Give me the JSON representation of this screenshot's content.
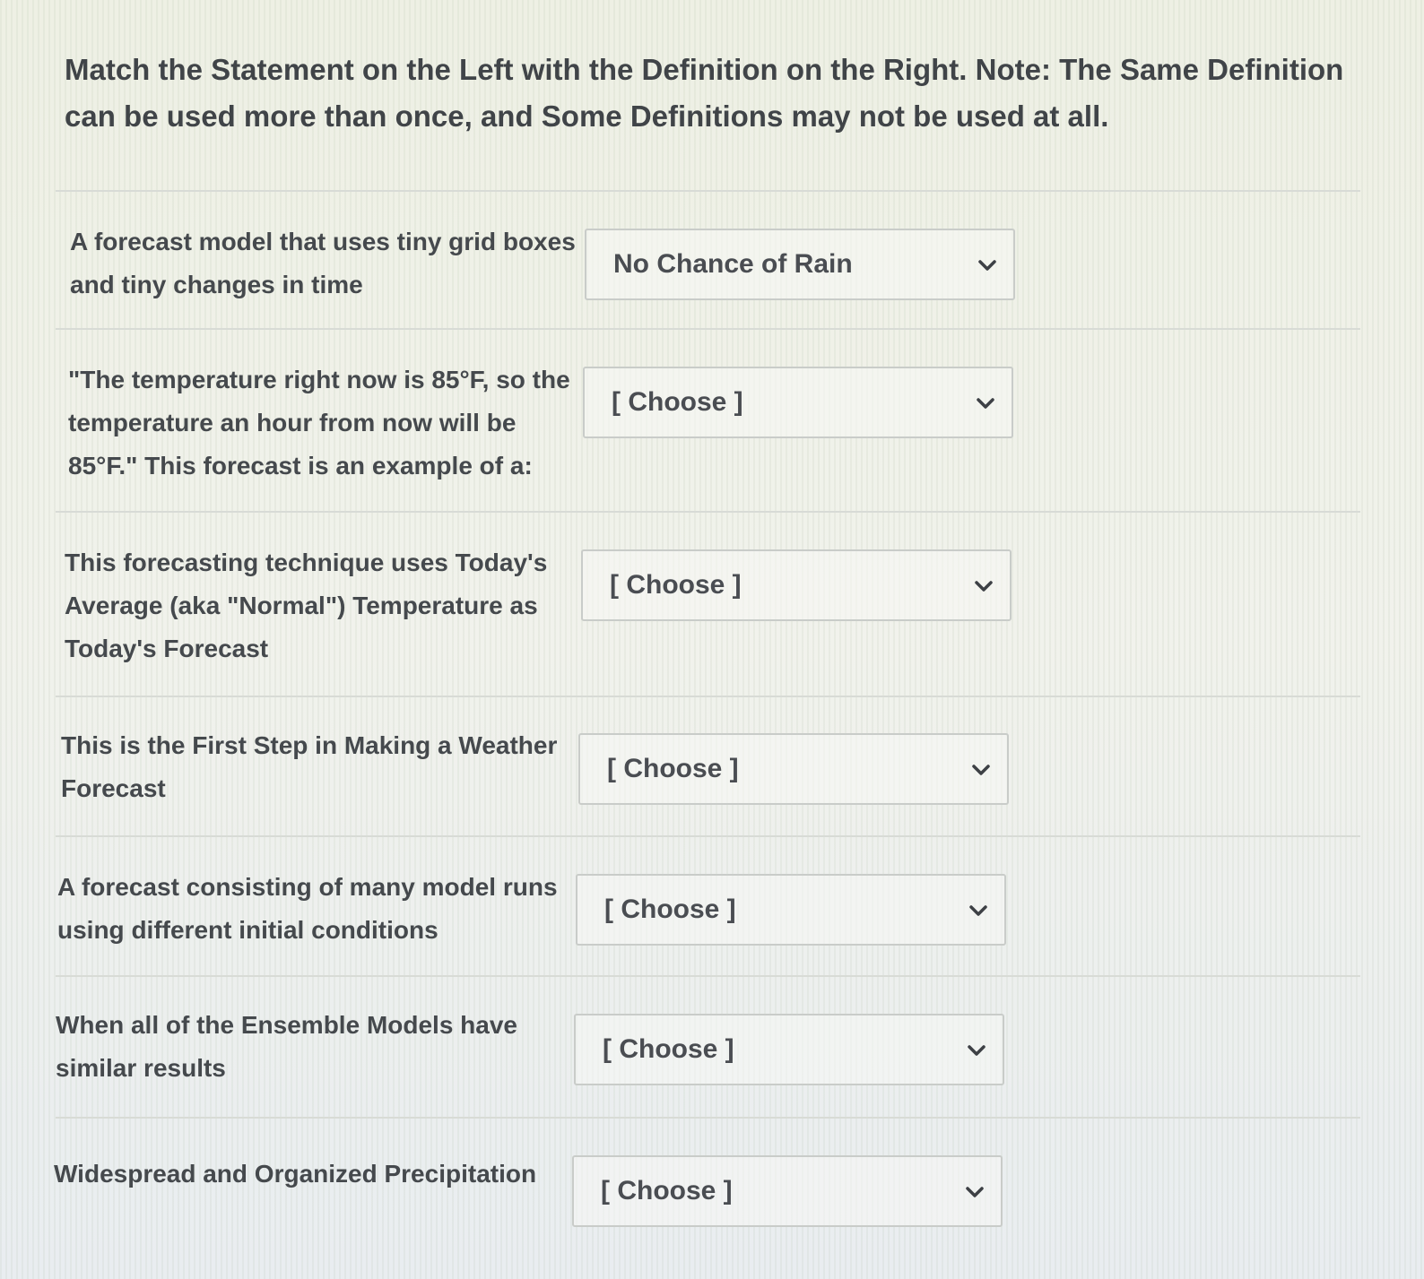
{
  "instructions": "Match the Statement on the Left with the Definition on the Right. Note: The Same Definition can be used more than once, and Some Definitions may not be used at all.",
  "items": [
    {
      "statement": "A forecast model that uses tiny grid boxes and tiny changes in time",
      "selected": "No Chance of Rain"
    },
    {
      "statement": "\"The temperature right now is 85°F, so the temperature an hour from now will be 85°F.\" This forecast is an example of a:",
      "selected": "[ Choose ]"
    },
    {
      "statement": "This forecasting technique uses Today's Average (aka \"Normal\") Temperature as Today's Forecast",
      "selected": "[ Choose ]"
    },
    {
      "statement": "This is the First Step in Making a Weather Forecast",
      "selected": "[ Choose ]"
    },
    {
      "statement": "A forecast consisting of many model runs using different initial conditions",
      "selected": "[ Choose ]"
    },
    {
      "statement": "When all of the Ensemble Models have similar results",
      "selected": "[ Choose ]"
    },
    {
      "statement": "Widespread and Organized Precipitation",
      "selected": "[ Choose ]"
    }
  ],
  "icons": {
    "dropdown": "chevron-down-icon"
  }
}
